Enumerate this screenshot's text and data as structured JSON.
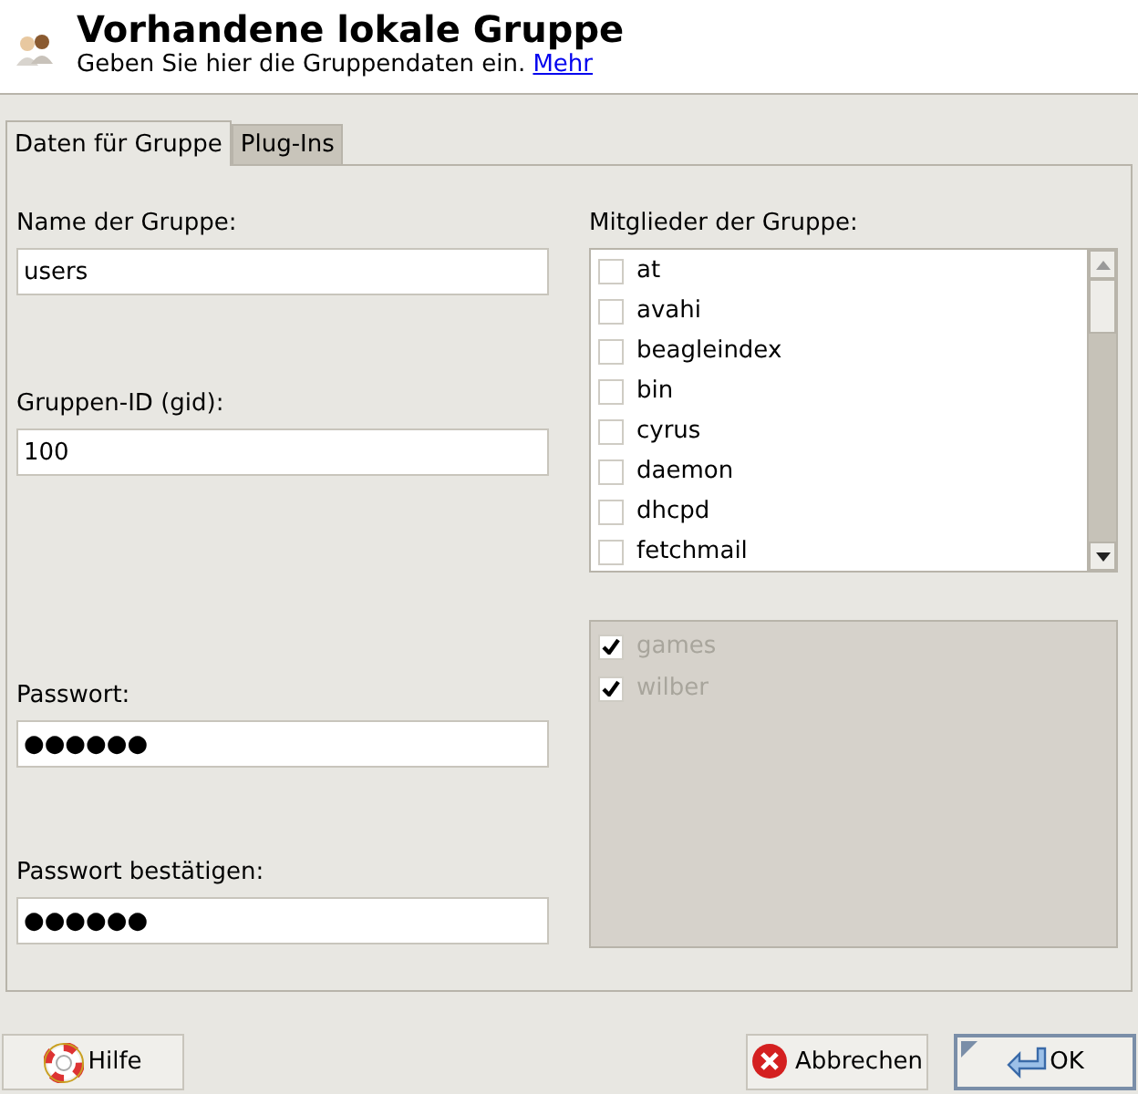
{
  "header": {
    "title": "Vorhandene lokale Gruppe",
    "subtitle": "Geben Sie hier die Gruppendaten ein.",
    "link": "Mehr"
  },
  "tabs": [
    {
      "label": "Daten für Gruppe",
      "selected": true
    },
    {
      "label": "Plug-Ins",
      "selected": false
    }
  ],
  "fields": [
    {
      "label": "Name der Gruppe:",
      "value": "users"
    },
    {
      "label": "Gruppen-ID (gid):",
      "value": "100"
    },
    {
      "label": "Passwort:",
      "value": "●●●●●●"
    },
    {
      "label": "Passwort bestätigen:",
      "value": "●●●●●●"
    }
  ],
  "members": {
    "label": "Mitglieder der Gruppe:",
    "items": [
      {
        "name": "at",
        "checked": false
      },
      {
        "name": "avahi",
        "checked": false
      },
      {
        "name": "beagleindex",
        "checked": false
      },
      {
        "name": "bin",
        "checked": false
      },
      {
        "name": "cyrus",
        "checked": false
      },
      {
        "name": "daemon",
        "checked": false
      },
      {
        "name": "dhcpd",
        "checked": false
      },
      {
        "name": "fetchmail",
        "checked": false
      }
    ]
  },
  "fixed_members": {
    "disabled": true,
    "items": [
      {
        "name": "games",
        "checked": true
      },
      {
        "name": "wilber",
        "checked": true
      }
    ]
  },
  "buttons": [
    {
      "label": "Hilfe",
      "kind": "help",
      "default": false
    },
    {
      "label": "Abbrechen",
      "kind": "cancel",
      "default": false
    },
    {
      "label": "OK",
      "kind": "ok",
      "default": true
    }
  ]
}
